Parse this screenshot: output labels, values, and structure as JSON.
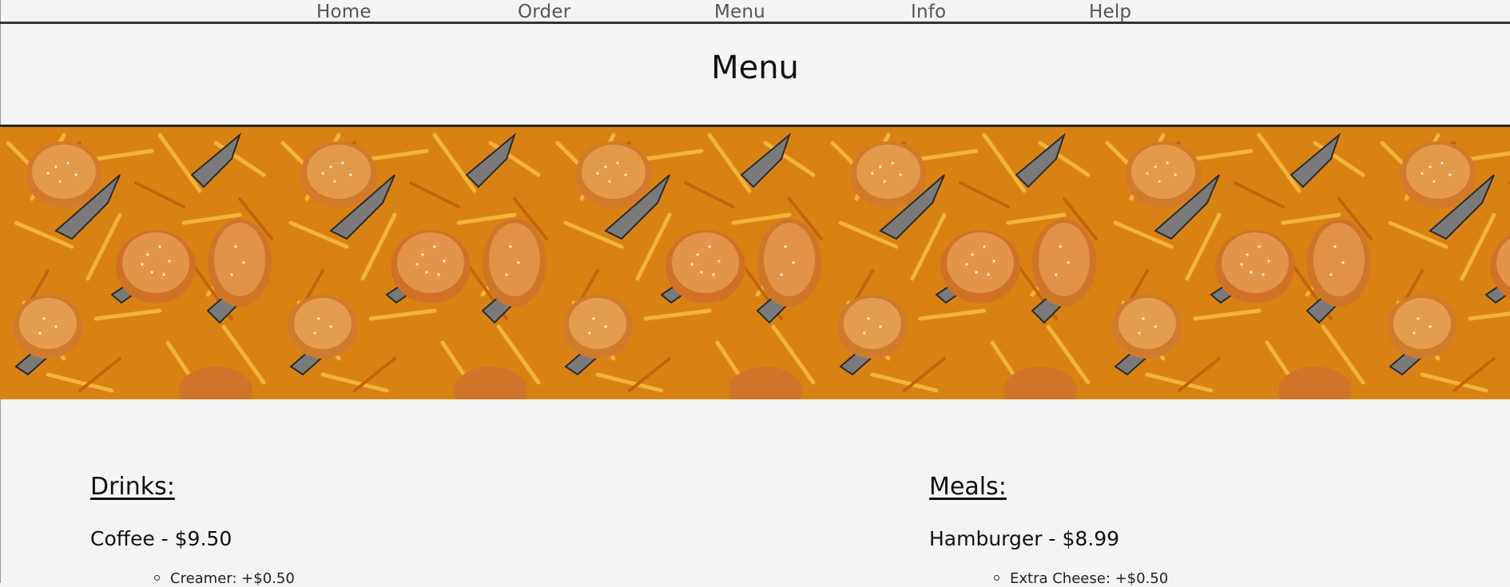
{
  "nav": {
    "items": [
      {
        "label": "Home"
      },
      {
        "label": "Order"
      },
      {
        "label": "Menu"
      },
      {
        "label": "Info"
      },
      {
        "label": "Help"
      }
    ]
  },
  "page": {
    "title": "Menu"
  },
  "banner": {
    "description_icon": "burgers-and-fries-banner"
  },
  "drinks": {
    "heading": "Drinks:",
    "items": [
      {
        "name": "Coffee - $9.50",
        "options": [
          "Creamer: +$0.50"
        ]
      }
    ]
  },
  "meals": {
    "heading": "Meals:",
    "items": [
      {
        "name": "Hamburger - $8.99",
        "options": [
          "Extra Cheese: +$0.50"
        ]
      }
    ]
  },
  "colors": {
    "background": "#f4f4f4",
    "nav_text": "#555555",
    "rule": "#333333",
    "fries": "#e39a1c",
    "bun": "#d9822b"
  }
}
